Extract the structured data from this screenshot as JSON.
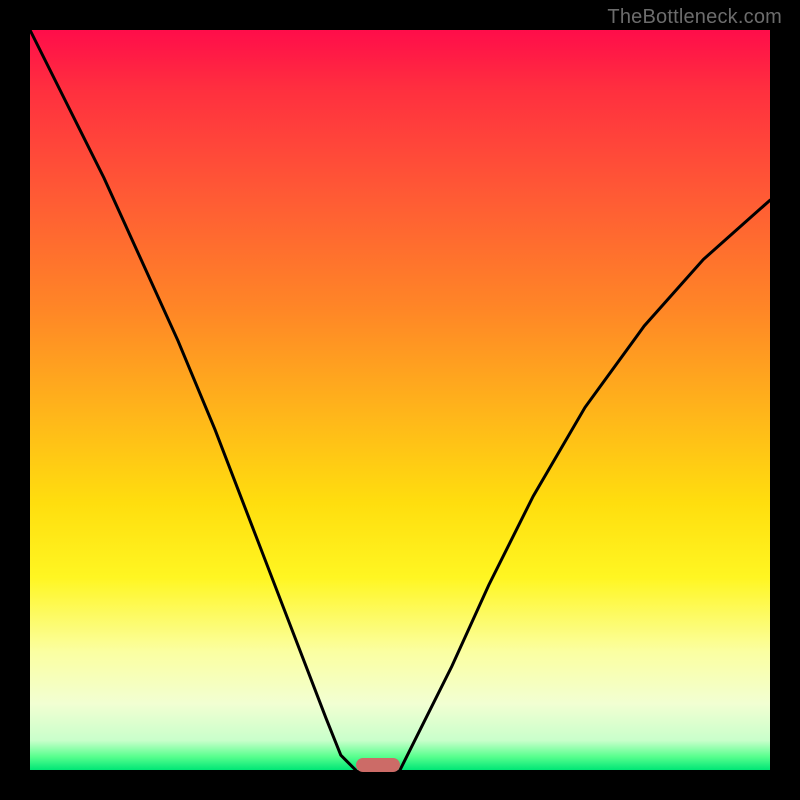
{
  "watermark": "TheBottleneck.com",
  "colors": {
    "frame": "#000000",
    "curve": "#000000",
    "marker": "#cc6b67",
    "gradient_top": "#ff0d4a",
    "gradient_bottom": "#00e676"
  },
  "chart_data": {
    "type": "line",
    "title": "",
    "xlabel": "",
    "ylabel": "",
    "xlim": [
      0,
      100
    ],
    "ylim": [
      0,
      100
    ],
    "series": [
      {
        "name": "left-curve",
        "x": [
          0,
          5,
          10,
          15,
          20,
          25,
          30,
          35,
          40,
          42,
          44
        ],
        "y": [
          100,
          90,
          80,
          69,
          58,
          46,
          33,
          20,
          7,
          2,
          0
        ]
      },
      {
        "name": "right-curve",
        "x": [
          50,
          53,
          57,
          62,
          68,
          75,
          83,
          91,
          100
        ],
        "y": [
          0,
          6,
          14,
          25,
          37,
          49,
          60,
          69,
          77
        ]
      }
    ],
    "annotations": [
      {
        "name": "bottleneck-marker",
        "x_center": 47,
        "y": 0,
        "width_pct": 6
      }
    ],
    "grid": false,
    "legend": false
  }
}
